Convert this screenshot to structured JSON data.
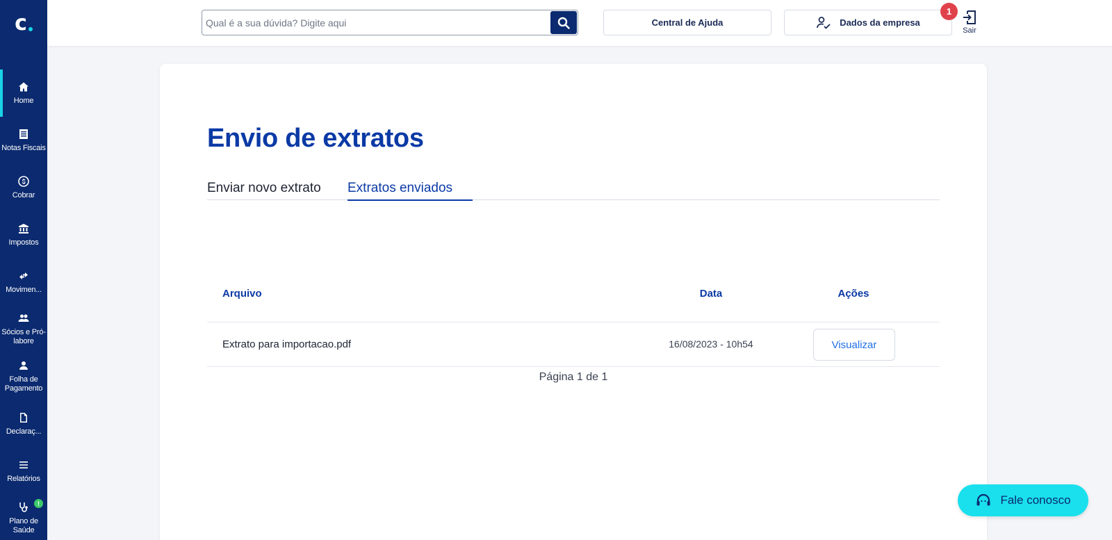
{
  "brand": {
    "logo_text": "c"
  },
  "sidebar": {
    "items": [
      {
        "label": "Home",
        "icon": "home-icon"
      },
      {
        "label": "Notas Fiscais",
        "icon": "document-list-icon"
      },
      {
        "label": "Cobrar",
        "icon": "dollar-circle-icon"
      },
      {
        "label": "Impostos",
        "icon": "bank-icon"
      },
      {
        "label": "Movimen...",
        "icon": "transfer-arrows-icon"
      },
      {
        "label": "Sócios e Pró-labore",
        "icon": "people-icon"
      },
      {
        "label": "Folha de Pagamento",
        "icon": "person-icon"
      },
      {
        "label": "Declaraç...",
        "icon": "file-icon"
      },
      {
        "label": "Relatórios",
        "icon": "list-icon"
      },
      {
        "label": "Plano de Saúde",
        "icon": "stethoscope-icon",
        "badge": "!"
      }
    ]
  },
  "header": {
    "search_placeholder": "Qual é a sua dúvida? Digite aqui",
    "help_label": "Central de Ajuda",
    "company_label": "Dados da empresa",
    "notification_count": "1",
    "logout_label": "Sair"
  },
  "main": {
    "title": "Envio de extratos",
    "tabs": [
      {
        "label": "Enviar novo extrato",
        "active": false
      },
      {
        "label": "Extratos enviados",
        "active": true
      }
    ],
    "table": {
      "columns": [
        "Arquivo",
        "Data",
        "Ações"
      ],
      "rows": [
        {
          "file": "Extrato para importacao.pdf",
          "date": "16/08/2023 - 10h54",
          "action": "Visualizar"
        }
      ]
    },
    "pagination": "Página 1 de 1"
  },
  "fab": {
    "label": "Fale conosco",
    "icon": "headset-icon"
  },
  "colors": {
    "sidebar": "#0b2a6f",
    "accent": "#0b3aa5",
    "cyan": "#19e0ec",
    "link": "#1f6fe5",
    "alert": "#e0424c"
  }
}
